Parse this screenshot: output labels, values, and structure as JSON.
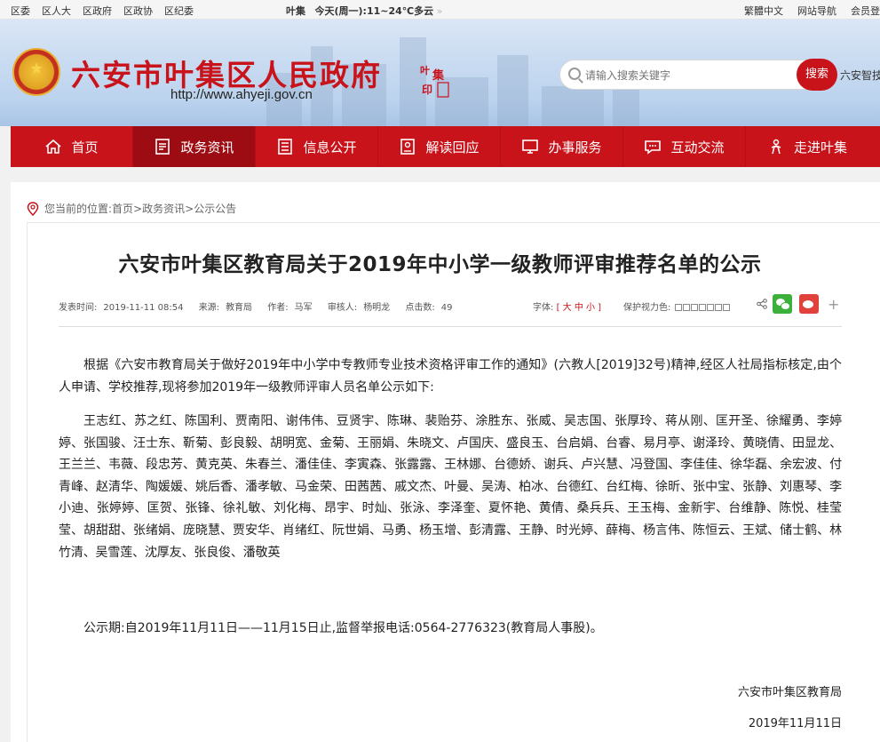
{
  "topbar": {
    "links": [
      "区委",
      "区人大",
      "区政府",
      "区政协",
      "区纪委"
    ],
    "weather_city": "叶集",
    "weather_text": "今天(周一):11~24℃多云",
    "right_links": [
      "繁體中文",
      "网站导航",
      "会员登"
    ]
  },
  "header": {
    "site_name": "六安市叶集区人民政府",
    "site_url": "http://www.ahyeji.gov.cn",
    "seal_text": "叶集印",
    "search_placeholder": "请输入搜索关键字",
    "search_button": "搜索",
    "smart_label": "六安智技"
  },
  "nav": [
    {
      "label": "首页",
      "icon": "home-icon"
    },
    {
      "label": "政务资讯",
      "icon": "document-icon",
      "active": true
    },
    {
      "label": "信息公开",
      "icon": "list-icon"
    },
    {
      "label": "解读回应",
      "icon": "reply-icon"
    },
    {
      "label": "办事服务",
      "icon": "monitor-icon"
    },
    {
      "label": "互动交流",
      "icon": "chat-icon"
    },
    {
      "label": "走进叶集",
      "icon": "person-icon"
    }
  ],
  "breadcrumb": {
    "prefix": "您当前的位置:",
    "items": [
      "首页",
      "政务资讯",
      "公示公告"
    ],
    "separator": " > "
  },
  "article": {
    "title": "六安市叶集区教育局关于2019年中小学一级教师评审推荐名单的公示",
    "meta": {
      "publish_time_label": "发表时间:",
      "publish_time": "2019-11-11 08:54",
      "source_label": "来源:",
      "source": "教育局",
      "author_label": "作者:",
      "author": "马军",
      "reviewer_label": "审核人:",
      "reviewer": "杨明龙",
      "clicks_label": "点击数:",
      "clicks": "49",
      "font_label": "字体:",
      "font_sizes": "[ 大 中 小 ]",
      "vision_label": "保护视力色:"
    },
    "paragraph1": "根据《六安市教育局关于做好2019年中小学中专教师专业技术资格评审工作的通知》(六教人[2019]32号)精神,经区人社局指标核定,由个人申请、学校推荐,现将参加2019年一级教师评审人员名单公示如下:",
    "names": "王志红、苏之红、陈国利、贾南阳、谢伟伟、豆贤宇、陈琳、裴贻芬、涂胜东、张威、吴志国、张厚玲、蒋从刚、匡开圣、徐耀勇、李婷婷、张国骏、汪士东、靳菊、彭良毅、胡明宽、金菊、王丽娟、朱晓文、卢国庆、盛良玉、台启娟、台睿、易月亭、谢泽玲、黄晓倩、田显龙、王兰兰、韦薇、段忠芳、黄克英、朱春兰、潘佳佳、李寅森、张露露、王林娜、台德娇、谢兵、卢兴慧、冯登国、李佳佳、徐华磊、余宏波、付青峰、赵清华、陶媛媛、姚后香、潘孝敏、马金荣、田茜茜、戚文杰、叶曼、吴涛、柏冰、台德红、台红梅、徐昕、张中宝、张静、刘惠琴、李小迪、张婷婷、匡贺、张锋、徐礼敏、刘化梅、昂宇、时灿、张泳、李泽奎、夏怀艳、黄倩、桑兵兵、王玉梅、金新宇、台维静、陈悦、桂莹莹、胡甜甜、张绪娟、庞晓慧、贾安华、肖绪红、阮世娟、马勇、杨玉增、彭清露、王静、时光婷、薛梅、杨言伟、陈恒云、王斌、储士鹤、林竹清、吴雪莲、沈厚友、张良俊、潘敬英",
    "period": "公示期:自2019年11月11日——11月15日止,监督举报电话:0564-2776323(教育局人事股)。",
    "signature": "六安市叶集区教育局",
    "sign_date": "2019年11月11日"
  }
}
